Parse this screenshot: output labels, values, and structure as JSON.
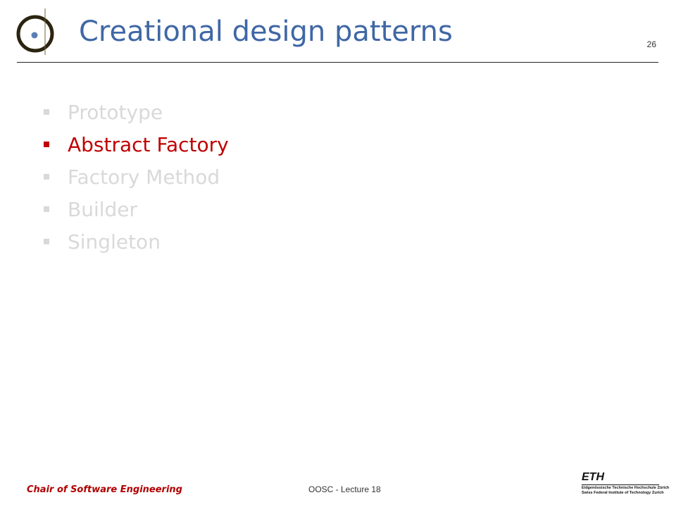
{
  "slide": {
    "title": "Creational design patterns",
    "number": "26"
  },
  "bullets": [
    {
      "label": "Prototype",
      "active": false
    },
    {
      "label": "Abstract Factory",
      "active": true
    },
    {
      "label": "Factory Method",
      "active": false
    },
    {
      "label": "Builder",
      "active": false
    },
    {
      "label": "Singleton",
      "active": false
    }
  ],
  "footer": {
    "left": "Chair of Software Engineering",
    "center": "OOSC - Lecture 18",
    "eth_mark": "ETH",
    "eth_line1": "Eidgenössische Technische Hochschule Zürich",
    "eth_line2": "Swiss Federal Institute of Technology Zurich"
  },
  "colors": {
    "title": "#3f67a5",
    "active_bullet": "#c00000",
    "inactive_bullet": "#d9d9d9",
    "footer_left": "#b00000"
  },
  "icons": {
    "logo": "chair-logo-circle-icon"
  }
}
